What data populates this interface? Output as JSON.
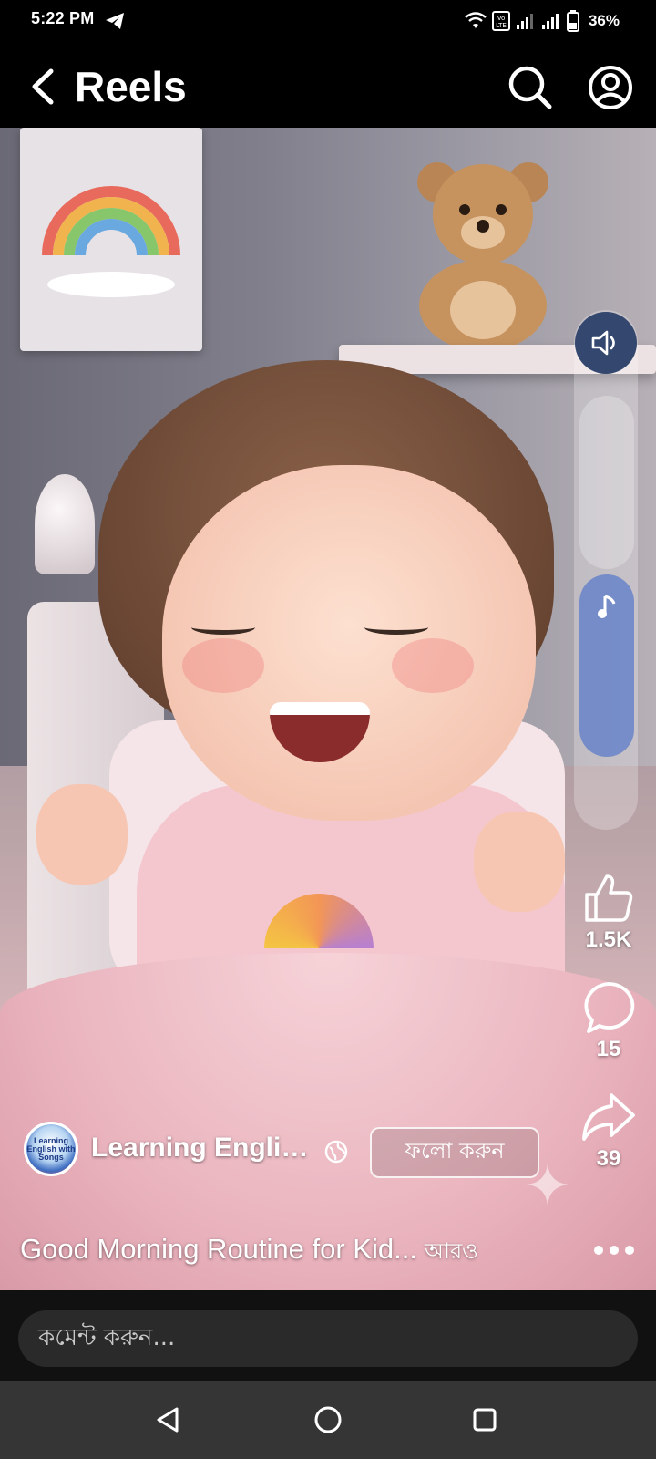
{
  "status_bar": {
    "time": "5:22 PM",
    "battery": "36%",
    "icons": [
      "telegram-icon",
      "wifi-icon",
      "volte-icon",
      "signal-icon",
      "signal-icon",
      "battery-icon"
    ]
  },
  "header": {
    "title": "Reels",
    "icons": [
      "back-arrow-icon",
      "search-icon",
      "profile-icon"
    ]
  },
  "reel": {
    "actions": {
      "likes": "1.5K",
      "comments": "15",
      "shares": "39"
    },
    "channel": {
      "name": "Learning English For Kids",
      "avatar_text": "Learning English with Songs",
      "follow_label": "ফলো করুন"
    },
    "caption": "Good Morning Routine for Kid...",
    "caption_more": "আরও"
  },
  "comment": {
    "placeholder": "কমেন্ট করুন..."
  },
  "nav": {
    "icons": [
      "back-triangle-icon",
      "home-circle-icon",
      "recents-square-icon"
    ]
  },
  "colors": {
    "background": "#000000",
    "volume_button": "#34486f",
    "music_pill": "#6280c9",
    "comment_input": "#2a2a2a",
    "nav_bar": "#353535"
  }
}
